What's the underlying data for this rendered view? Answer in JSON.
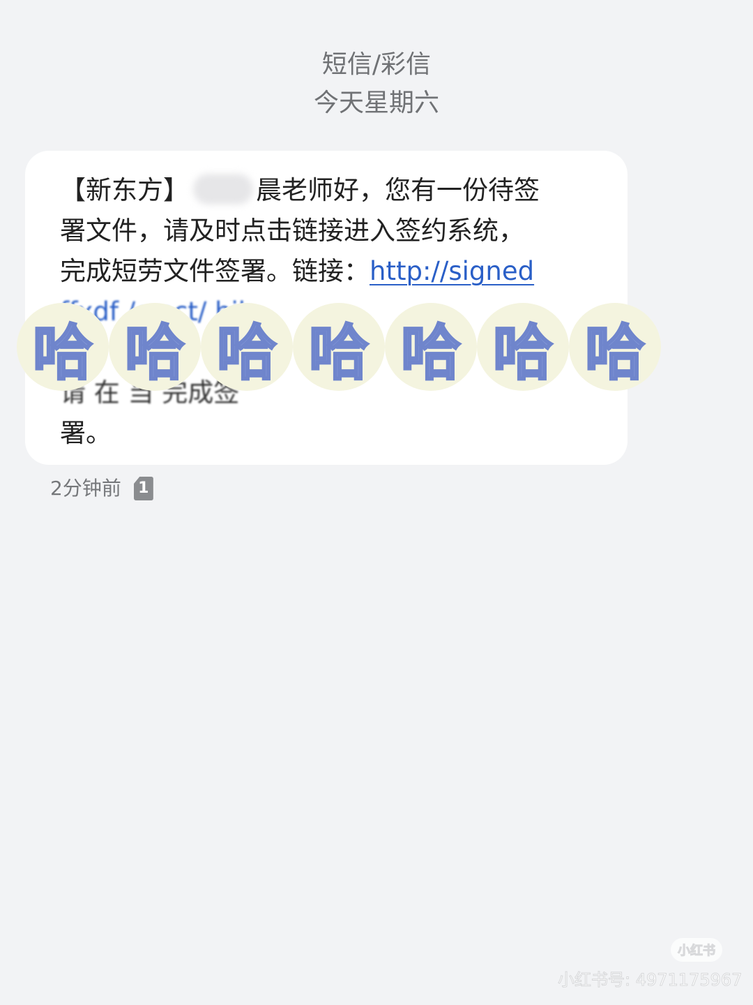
{
  "header": {
    "message_type": "短信/彩信",
    "date": "今天星期六"
  },
  "message": {
    "line1_prefix": "【新东方】",
    "line1_suffix": "晨老师好，您有一份待签",
    "line2": "署文件，请及时点击链接进入签约系统，",
    "line3_text": "完成短劳文件签署。链接：",
    "link_visible": "http://signed",
    "link_obscured": "ffxdf /c ect/ hil",
    "line5_obscured": "请 在 当 完成签",
    "line6": "署。"
  },
  "overlay": {
    "char": "哈",
    "count": 7,
    "fill_color": "#8196d6",
    "bubble_color": "#f4f4df"
  },
  "meta": {
    "time": "2分钟前",
    "sim": "1"
  },
  "watermark": {
    "logo": "小红书",
    "id": "小红书号: 4971175967"
  },
  "colors": {
    "background": "#f2f3f5",
    "bubble": "#ffffff",
    "link": "#2a5fc7"
  }
}
